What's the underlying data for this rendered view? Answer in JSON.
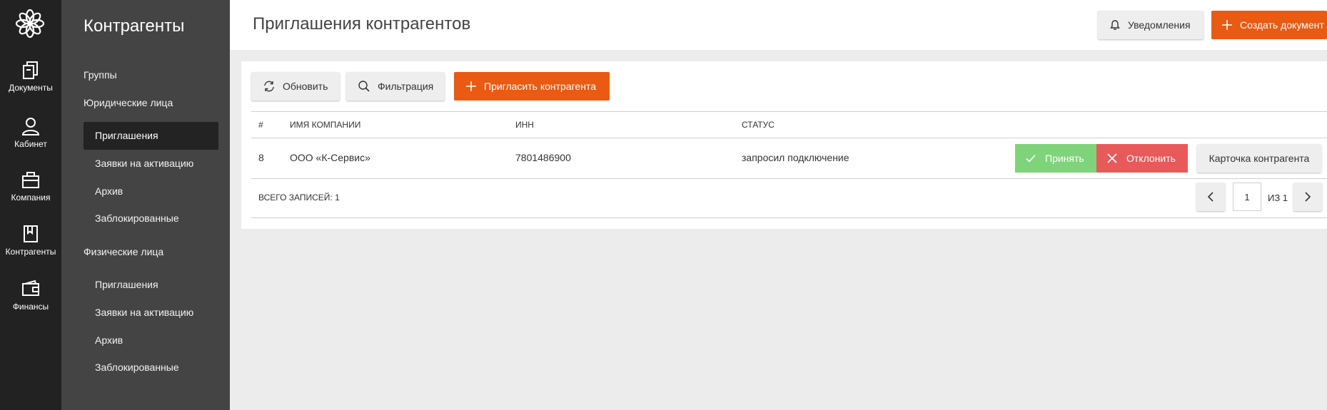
{
  "rail": {
    "items": [
      {
        "label": "Документы",
        "icon": "documents-icon"
      },
      {
        "label": "Кабинет",
        "icon": "user-icon"
      },
      {
        "label": "Компания",
        "icon": "company-icon"
      },
      {
        "label": "Контрагенты",
        "icon": "bookmark-book-icon"
      },
      {
        "label": "Финансы",
        "icon": "wallet-icon"
      }
    ]
  },
  "subnav": {
    "title": "Контрагенты",
    "groups_label": "Группы",
    "legal_label": "Юридические лица",
    "legal_children": [
      "Приглашения",
      "Заявки на активацию",
      "Архив",
      "Заблокированные"
    ],
    "individuals_label": "Физические лица",
    "individual_children": [
      "Приглашения",
      "Заявки на активацию",
      "Архив",
      "Заблокированные"
    ]
  },
  "header": {
    "title": "Приглашения контрагентов",
    "notifications_label": "Уведомления",
    "create_label": "Создать документ"
  },
  "toolbar": {
    "refresh_label": "Обновить",
    "filter_label": "Фильтрация",
    "invite_label": "Пригласить контрагента"
  },
  "table": {
    "columns": [
      "#",
      "ИМЯ КОМПАНИИ",
      "ИНН",
      "СТАТУС"
    ],
    "rows": [
      {
        "num": "8",
        "company": "ООО «К-Сервис»",
        "inn": "7801486900",
        "status": "запросил подключение",
        "accept_label": "Принять",
        "reject_label": "Отклонить",
        "card_label": "Карточка контрагента"
      }
    ]
  },
  "footer": {
    "total_label": "ВСЕГО ЗАПИСЕЙ: 1",
    "page_value": "1",
    "page_of": "ИЗ 1"
  },
  "colors": {
    "accent": "#ea5a13",
    "accept": "#7fd37a",
    "reject": "#e85a5a",
    "rail_bg": "#222222",
    "subnav_bg": "#444444"
  }
}
